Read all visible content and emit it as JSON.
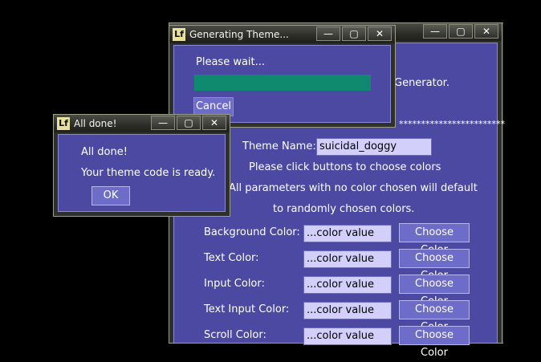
{
  "main_window": {
    "title": "",
    "controls": {
      "minimize": "—",
      "maximize": "▢",
      "close": "✕"
    },
    "generator_text": "Generator.",
    "stars": "************************",
    "theme_name_label": "Theme Name:",
    "theme_name_value": "suicidal_doggy",
    "instruction_1": "Please click buttons to choose colors",
    "instruction_2": "All parameters with no color chosen will default",
    "instruction_3": "to randomly chosen colors.",
    "rows": [
      {
        "label": "Background Color:",
        "value": "...color value",
        "button": "Choose Color"
      },
      {
        "label": "Text Color:",
        "value": "...color value",
        "button": "Choose Color"
      },
      {
        "label": "Input Color:",
        "value": "...color value",
        "button": "Choose Color"
      },
      {
        "label": "Text Input Color:",
        "value": "...color value",
        "button": "Choose Color"
      },
      {
        "label": "Scroll Color:",
        "value": "...color value",
        "button": "Choose Color"
      }
    ]
  },
  "progress_window": {
    "title": "Generating Theme...",
    "logo": "Lf",
    "controls": {
      "minimize": "—",
      "maximize": "▢",
      "close": "✕"
    },
    "message": "Please wait...",
    "progress": 1.0,
    "cancel_label": "Cancel",
    "bar_color": "#0f8a6e"
  },
  "done_window": {
    "title": "All done!",
    "logo": "Lf",
    "controls": {
      "minimize": "—",
      "maximize": "▢",
      "close": "✕"
    },
    "line1": "All done!",
    "line2": "Your theme code is ready.",
    "ok_label": "OK"
  },
  "colors": {
    "panel": "#4b49a2",
    "field": "#d2d0fa",
    "button": "#6d6cc8",
    "background": "#000000"
  }
}
